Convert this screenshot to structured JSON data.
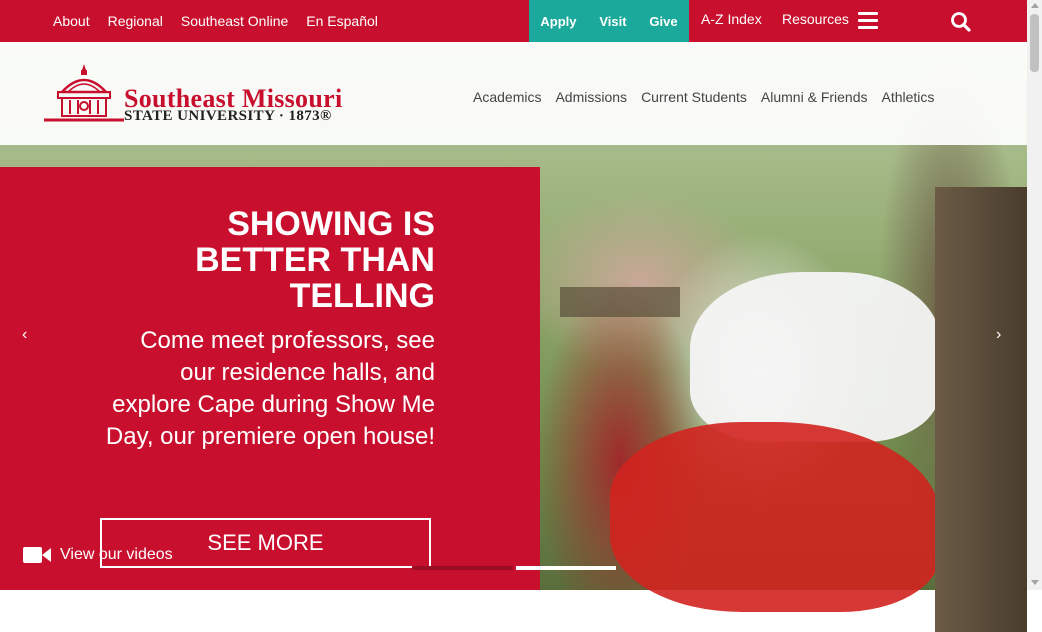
{
  "topbar": {
    "links": [
      "About",
      "Regional",
      "Southeast Online",
      "En Español"
    ],
    "cta": [
      "Apply",
      "Visit",
      "Give"
    ],
    "az_index": "A-Z Index",
    "resources": "Resources"
  },
  "logo": {
    "line1": "Southeast Missouri",
    "line2": "STATE UNIVERSITY · 1873®"
  },
  "mainnav": [
    "Academics",
    "Admissions",
    "Current Students",
    "Alumni & Friends",
    "Athletics"
  ],
  "hero": {
    "headline": "SHOWING IS BETTER THAN TELLING",
    "subtext": "Come meet professors, see our residence halls, and explore Cape during Show Me Day, our premiere open house!",
    "button": "SEE MORE",
    "prev": "‹",
    "next": "›",
    "videos_label": "View our videos"
  },
  "colors": {
    "brand_red": "#c8102e",
    "cta_teal": "#1aa99a"
  }
}
